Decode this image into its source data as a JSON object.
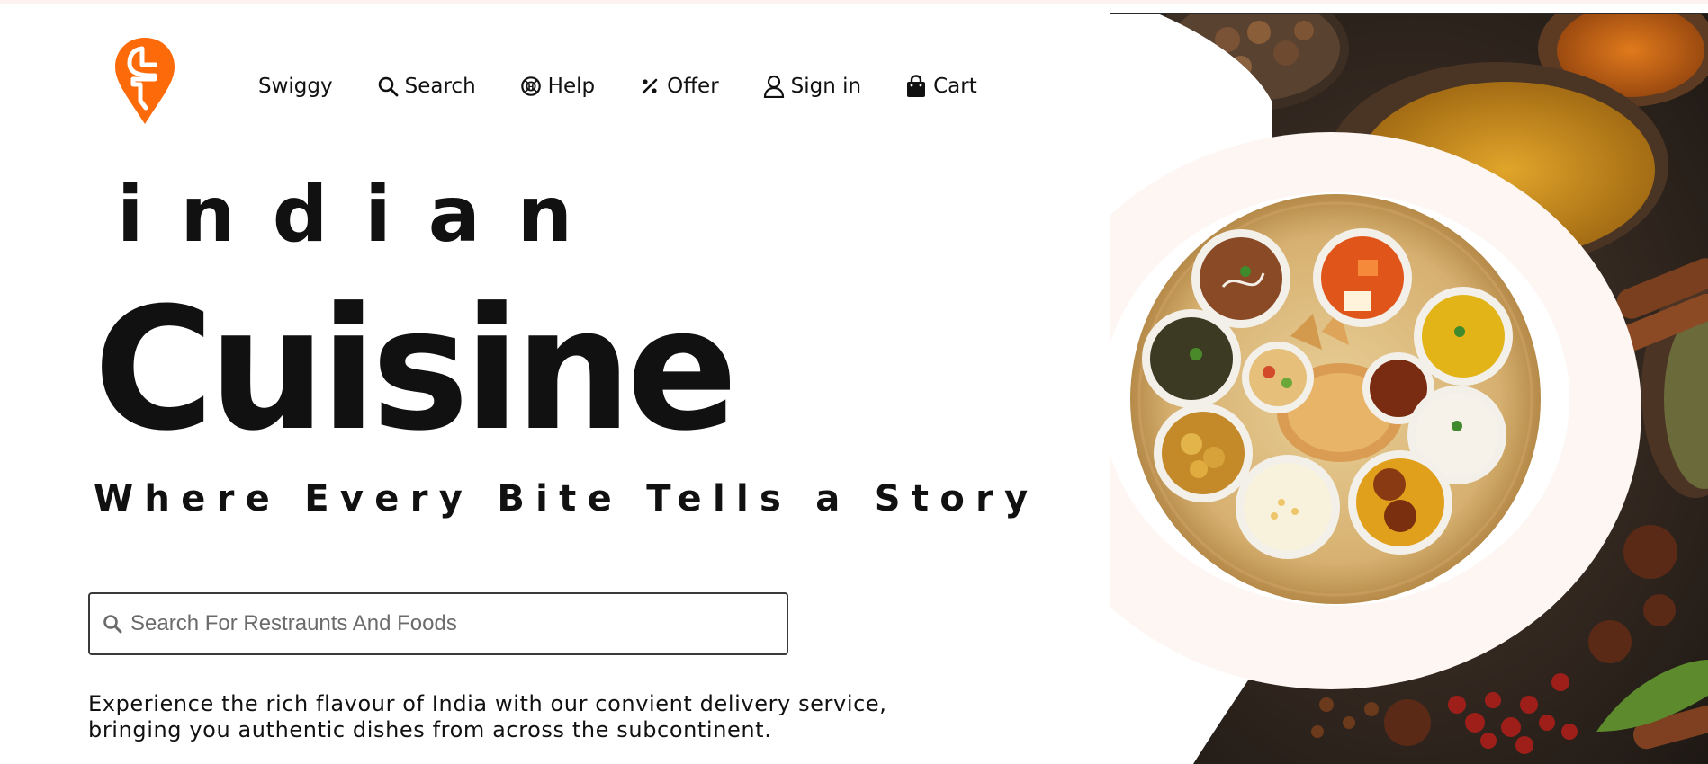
{
  "brand": {
    "logo_icon": "swiggy-logo",
    "accent_color": "#fc6a0a"
  },
  "nav": {
    "items": [
      {
        "label": "Swiggy",
        "icon": ""
      },
      {
        "label": "Search",
        "icon": "search-icon"
      },
      {
        "label": "Help",
        "icon": "help-lifebuoy-icon"
      },
      {
        "label": "Offer",
        "icon": "percent-icon"
      },
      {
        "label": "Sign in",
        "icon": "user-icon"
      },
      {
        "label": "Cart",
        "icon": "shopping-bag-icon"
      }
    ]
  },
  "hero": {
    "title_small": "indian",
    "title_large": "Cuisine",
    "tagline": "Where Every Bite Tells a Story"
  },
  "search": {
    "placeholder": "Search For Restraunts And Foods",
    "value": "",
    "icon": "search-icon"
  },
  "description": {
    "line1": "Experience the rich flavour of India with our convient delivery service,",
    "line2": "bringing you authentic dishes from across the subcontinent."
  },
  "image": {
    "subject": "indian-thali-platter-with-spices"
  }
}
